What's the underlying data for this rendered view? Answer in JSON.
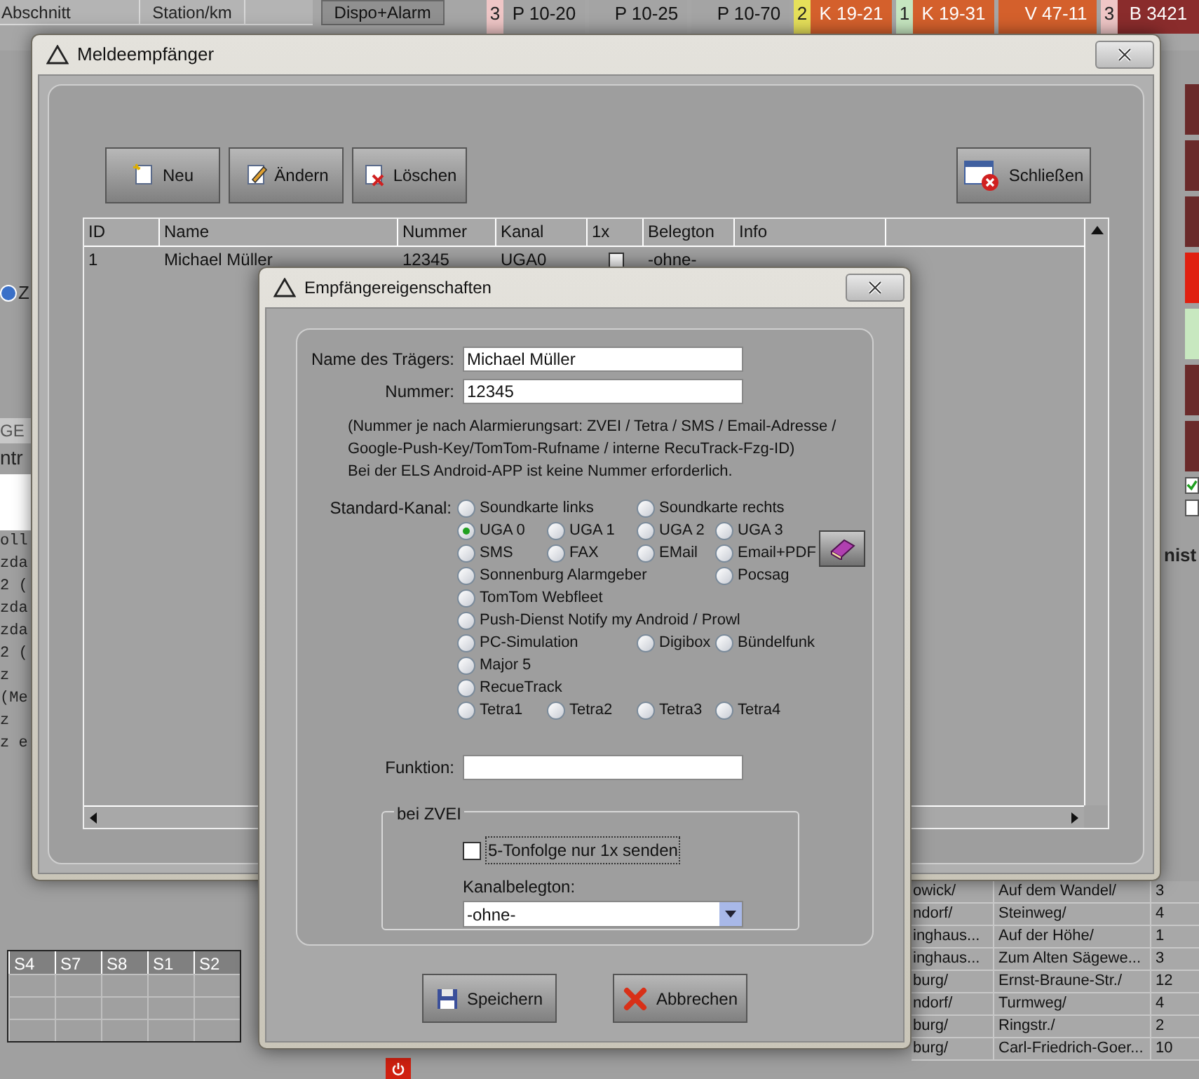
{
  "background": {
    "top_headers": [
      "Abschnitt",
      "Station/km"
    ],
    "dispatch_button": "Dispo+Alarm",
    "vehicles": [
      {
        "count": {
          "text": "3",
          "color": "#efc6c6"
        },
        "name": "P 10-20",
        "color": "#a4a4a4"
      },
      {
        "name": "P 10-25",
        "color": "#a4a4a4"
      },
      {
        "name": "P 10-70",
        "color": "#a4a4a4"
      },
      {
        "count": {
          "text": "2",
          "color": "#e6e05a"
        },
        "name": "K 19-21",
        "color": "#d4602c"
      },
      {
        "count": {
          "text": "1",
          "color": "#c6e6c0"
        },
        "name": "K 19-31",
        "color": "#d4602c"
      },
      {
        "name": "V 47-11",
        "color": "#d4602c"
      },
      {
        "count": {
          "text": "3",
          "color": "#efc6c6"
        },
        "name": "B 3421",
        "color": "#8a2c2c"
      }
    ],
    "left_fragments": [
      "Z",
      "GE",
      "ntr",
      "oll",
      "zda",
      "2 (",
      "zda",
      "zda",
      "2 (",
      "z",
      "(Me",
      "z",
      "z e"
    ],
    "side_label": "nist",
    "side_checkboxes": [
      {
        "checked": true
      },
      {
        "checked": false
      }
    ],
    "status_table": {
      "columns": [
        "S4",
        "S7",
        "S8",
        "S1",
        "S2"
      ]
    },
    "address_rows": [
      {
        "place": "owick/",
        "street": "Auf dem Wandel/",
        "number": "3"
      },
      {
        "place": "ndorf/",
        "street": "Steinweg/",
        "number": "4"
      },
      {
        "place": "inghaus...",
        "street": "Auf der Höhe/",
        "number": "1"
      },
      {
        "place": "inghaus...",
        "street": "Zum Alten Sägewe...",
        "number": "3"
      },
      {
        "place": "burg/",
        "street": "Ernst-Braune-Str./",
        "number": "12"
      },
      {
        "place": "ndorf/",
        "street": "Turmweg/",
        "number": "4"
      },
      {
        "place": "burg/",
        "street": "Ringstr./",
        "number": "2"
      },
      {
        "place": "burg/",
        "street": "Carl-Friedrich-Goer...",
        "number": "10"
      }
    ]
  },
  "list_window": {
    "title": "Meldeempfänger",
    "toolbar": [
      {
        "kind": "new",
        "label": "Neu"
      },
      {
        "kind": "edit",
        "label": "Ändern"
      },
      {
        "kind": "delete",
        "label": "Löschen"
      }
    ],
    "close_button": "Schließen",
    "table": {
      "columns": [
        "ID",
        "Name",
        "Nummer",
        "Kanal",
        "1x",
        "Belegton",
        "Info"
      ],
      "rows": [
        {
          "id": "1",
          "name": "Michael Müller",
          "number": "12345",
          "channel": "UGA0",
          "once": false,
          "tone": "-ohne-"
        }
      ]
    }
  },
  "dialog": {
    "title": "Empfängereigenschaften",
    "name_label": "Name des Trägers:",
    "name_value": "Michael Müller",
    "number_label": "Nummer:",
    "number_value": "12345",
    "note_lines": [
      "(Nummer je nach Alarmierungsart: ZVEI / Tetra / SMS / Email-Adresse /",
      "Google-Push-Key/TomTom-Rufname / interne RecuTrack-Fzg-ID)",
      "Bei der ELS Android-APP ist keine Nummer erforderlich."
    ],
    "channel_label": "Standard-Kanal:",
    "channel_rows": [
      [
        {
          "label": "Soundkarte links",
          "selected": false
        },
        null,
        {
          "label": "Soundkarte rechts",
          "selected": false
        },
        null
      ],
      [
        {
          "label": "UGA 0",
          "selected": true
        },
        {
          "label": "UGA 1",
          "selected": false
        },
        {
          "label": "UGA 2",
          "selected": false
        },
        {
          "label": "UGA 3",
          "selected": false
        }
      ],
      [
        {
          "label": "SMS",
          "selected": false
        },
        {
          "label": "FAX",
          "selected": false
        },
        {
          "label": "EMail",
          "selected": false
        },
        {
          "label": "Email+PDF",
          "selected": false
        }
      ],
      [
        {
          "label": "Sonnenburg Alarmgeber",
          "selected": false
        },
        null,
        null,
        {
          "label": "Pocsag",
          "selected": false
        }
      ],
      [
        {
          "label": "TomTom Webfleet",
          "selected": false
        },
        null,
        null,
        null
      ],
      [
        {
          "label": "Push-Dienst Notify my Android / Prowl",
          "selected": false
        },
        null,
        null,
        null
      ],
      [
        {
          "label": "PC-Simulation",
          "selected": false
        },
        null,
        {
          "label": "Digibox",
          "selected": false
        },
        {
          "label": "Bündelfunk",
          "selected": false
        }
      ],
      [
        {
          "label": "Major 5",
          "selected": false
        },
        null,
        null,
        null
      ],
      [
        {
          "label": "RecueTrack",
          "selected": false
        },
        null,
        null,
        null
      ],
      [
        {
          "label": "Tetra1",
          "selected": false
        },
        {
          "label": "Tetra2",
          "selected": false
        },
        {
          "label": "Tetra3",
          "selected": false
        },
        {
          "label": "Tetra4",
          "selected": false
        }
      ]
    ],
    "function_label": "Funktion:",
    "zvei_group": {
      "title": "bei ZVEI",
      "once_label": "5-Tonfolge nur 1x senden",
      "once_checked": false,
      "tone_label": "Kanalbelegton:",
      "tone_value": "-ohne-"
    },
    "buttons": [
      {
        "kind": "save",
        "label": "Speichern"
      },
      {
        "kind": "cancel",
        "label": "Abbrechen"
      }
    ]
  }
}
